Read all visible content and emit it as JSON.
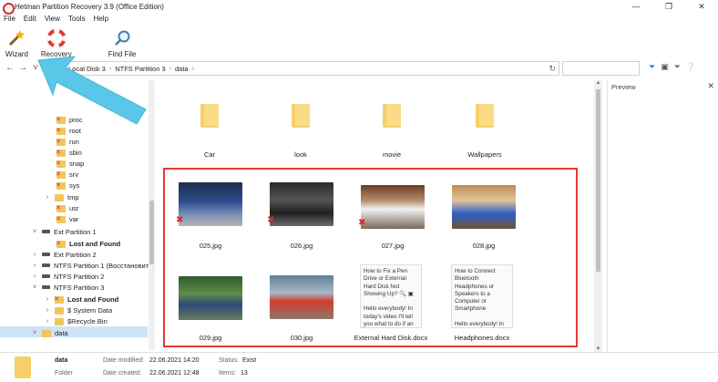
{
  "window": {
    "title": "Hetman Partition Recovery 3.9 (Office Edition)",
    "minimize_icon": "minimize-icon",
    "maximize_icon": "maximize-icon",
    "close_icon": "close-icon"
  },
  "menu": [
    "File",
    "Edit",
    "View",
    "Tools",
    "Help"
  ],
  "toolbar": {
    "wizard_label": "Wizard",
    "recovery_label": "Recovery",
    "find_file_label": "Find File"
  },
  "address": {
    "crumbs": [
      "Local Disk 3",
      "NTFS Partition 3",
      "data"
    ]
  },
  "tree": [
    {
      "label": "proc",
      "type": "folder-del"
    },
    {
      "label": "root",
      "type": "folder-del"
    },
    {
      "label": "run",
      "type": "folder-del"
    },
    {
      "label": "sbin",
      "type": "folder-del"
    },
    {
      "label": "snap",
      "type": "folder-del"
    },
    {
      "label": "srv",
      "type": "folder-del"
    },
    {
      "label": "sys",
      "type": "folder-del"
    },
    {
      "label": "tmp",
      "type": "folder"
    },
    {
      "label": "usr",
      "type": "folder-del"
    },
    {
      "label": "var",
      "type": "folder-del"
    },
    {
      "label": "Ext Partition 1",
      "type": "drive"
    },
    {
      "label": "Lost and Found",
      "type": "folder-del-bold"
    },
    {
      "label": "Ext Partition 2",
      "type": "drive"
    },
    {
      "label": "NTFS Partition 1 (Восстановить",
      "type": "drive"
    },
    {
      "label": "NTFS Partition 2",
      "type": "drive"
    },
    {
      "label": "NTFS Partition 3",
      "type": "drive"
    },
    {
      "label": "Lost and Found",
      "type": "folder-del-bold"
    },
    {
      "label": "$ System Data",
      "type": "folder"
    },
    {
      "label": "$Recycle.Bin",
      "type": "folder"
    },
    {
      "label": "data",
      "type": "folder"
    }
  ],
  "folders": [
    "Car",
    "look",
    "movie",
    "Wallpapers"
  ],
  "files": [
    {
      "name": "025.jpg",
      "deleted": true
    },
    {
      "name": "026.jpg",
      "deleted": true
    },
    {
      "name": "027.jpg",
      "deleted": true
    },
    {
      "name": "028.jpg",
      "deleted": false
    },
    {
      "name": "029.jpg",
      "deleted": false
    },
    {
      "name": "030.jpg",
      "deleted": false
    },
    {
      "name": "External Hard Disk.docx",
      "deleted": false,
      "preview": "How to Fix a Pen Drive or External Hard Disk Not Showing Up? 🔍 ▣\n\nHello everybody! In today's video I'll tell you what to do if an"
    },
    {
      "name": "Headphones.docx",
      "deleted": false,
      "preview": "How to Connect Bluetooth Headphones or Speakers to a Computer or Smartphone\n\nHello everybody! In"
    }
  ],
  "preview": {
    "title": "Preview"
  },
  "status": {
    "name": "data",
    "kind": "Folder",
    "modified_label": "Date modified:",
    "modified_value": "22.06.2021 14:20",
    "created_label": "Date created:",
    "created_value": "22.06.2021 12:48",
    "status_label": "Status:",
    "status_value": "Exist",
    "items_label": "Items:",
    "items_value": "13"
  },
  "colors": {
    "highlight": "#e53935",
    "overlay_arrow": "#5bc7e8",
    "folder": "#f6cf6a",
    "deleted_mark": "#d32f2f"
  }
}
